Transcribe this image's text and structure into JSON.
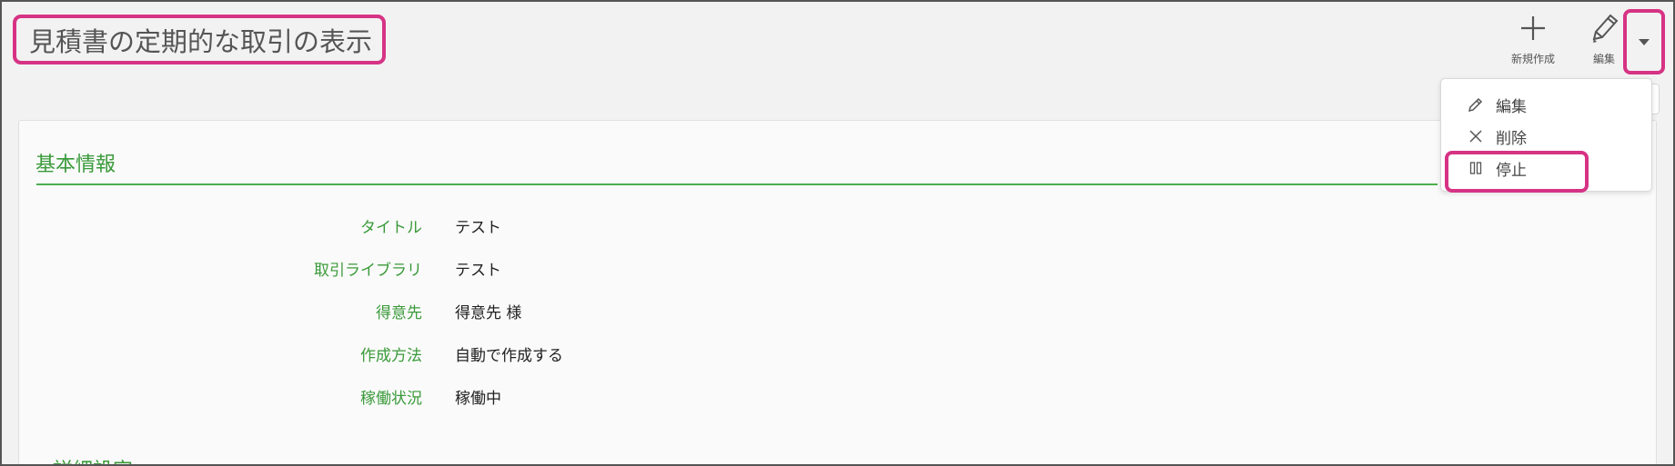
{
  "page": {
    "title": "見積書の定期的な取引の表示"
  },
  "toolbar": {
    "new_label": "新規作成",
    "edit_label": "編集",
    "new_icon": "plus-icon",
    "edit_icon": "pencil-icon",
    "dropdown_icon": "caret-down-icon"
  },
  "menu": {
    "items": [
      {
        "label": "編集",
        "icon": "pencil-icon"
      },
      {
        "label": "削除",
        "icon": "close-icon"
      },
      {
        "label": "停止",
        "icon": "pause-icon"
      }
    ]
  },
  "section": {
    "title": "基本情報",
    "fields": [
      {
        "label": "タイトル",
        "value": "テスト"
      },
      {
        "label": "取引ライブラリ",
        "value": "テスト"
      },
      {
        "label": "得意先",
        "value": "得意先 様"
      },
      {
        "label": "作成方法",
        "value": "自動で作成する"
      },
      {
        "label": "稼働状況",
        "value": "稼働中"
      }
    ]
  },
  "section2": {
    "title": "詳細設定"
  },
  "colors": {
    "accent_green": "#3a9a3a",
    "highlight_pink": "#d63384"
  }
}
